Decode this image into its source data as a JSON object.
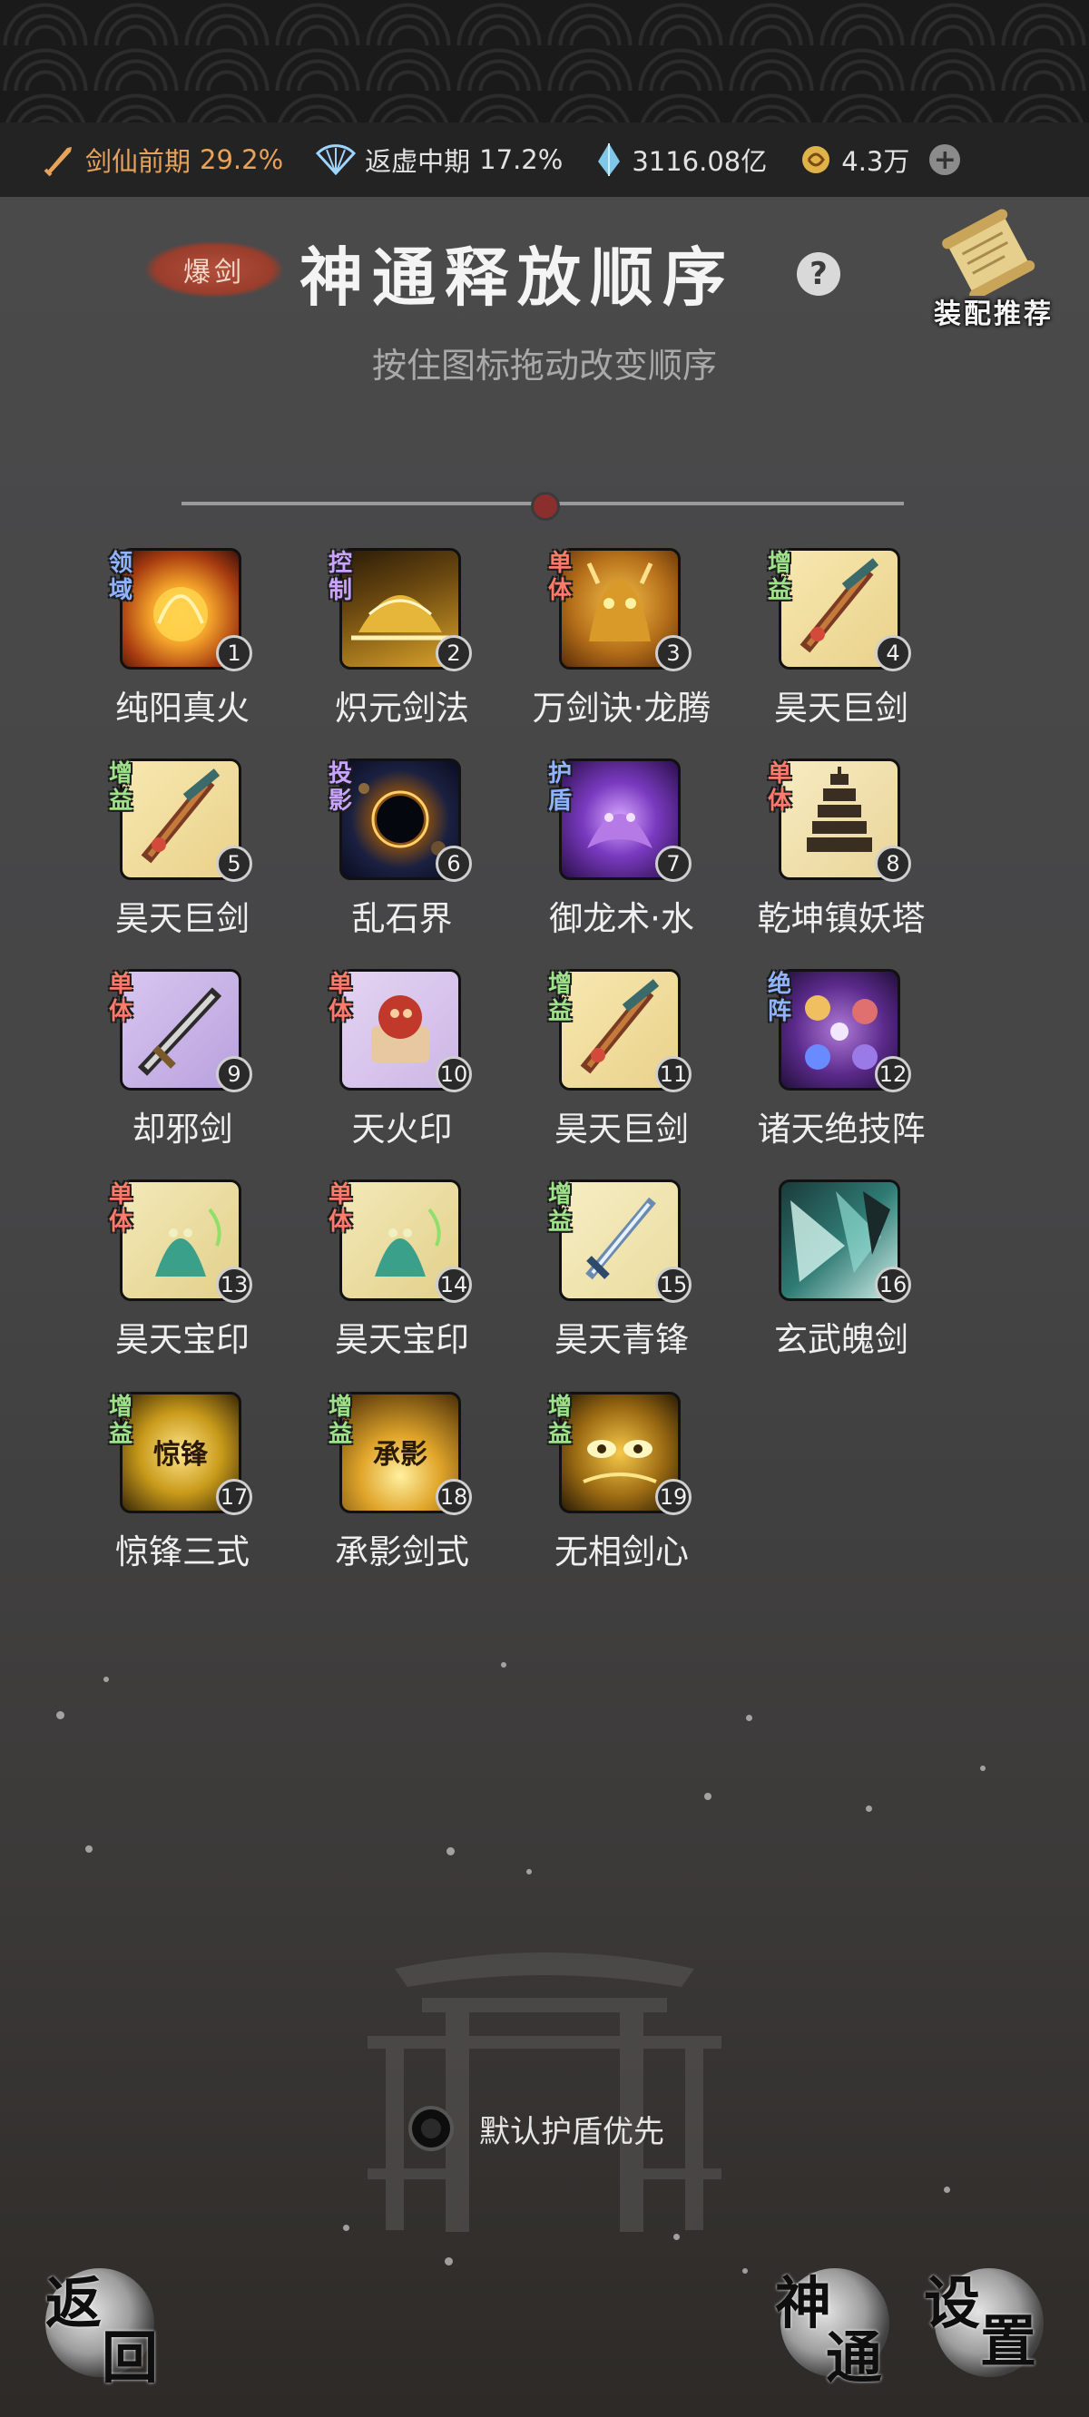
{
  "resources": {
    "sword_realm": {
      "label": "剑仙前期",
      "pct": "29.2%"
    },
    "void_realm": {
      "label": "返虚中期",
      "pct": "17.2%"
    },
    "crystals": "3116.08亿",
    "coins": "4.3万"
  },
  "header": {
    "tag": "爆剑",
    "title": "神通释放顺序",
    "help": "?",
    "recommend_label": "装配推荐",
    "subtitle": "按住图标拖动改变顺序"
  },
  "skills": [
    {
      "tag": "领域",
      "tag_color": "#8fb3ff",
      "num": "1",
      "name": "纯阳真火",
      "theme": "fire-orb"
    },
    {
      "tag": "控制",
      "tag_color": "#c9a3ff",
      "num": "2",
      "name": "炽元剑法",
      "theme": "gold-dome"
    },
    {
      "tag": "单体",
      "tag_color": "#ff7a6a",
      "num": "3",
      "name": "万剑诀·龙腾",
      "theme": "dragon"
    },
    {
      "tag": "增益",
      "tag_color": "#9ee28a",
      "num": "4",
      "name": "昊天巨剑",
      "theme": "great-sword"
    },
    {
      "tag": "增益",
      "tag_color": "#9ee28a",
      "num": "5",
      "name": "昊天巨剑",
      "theme": "great-sword"
    },
    {
      "tag": "投影",
      "tag_color": "#c9a3ff",
      "num": "6",
      "name": "乱石界",
      "theme": "eclipse"
    },
    {
      "tag": "护盾",
      "tag_color": "#8fb3ff",
      "num": "7",
      "name": "御龙术·水",
      "theme": "purple-dragon"
    },
    {
      "tag": "单体",
      "tag_color": "#ff7a6a",
      "num": "8",
      "name": "乾坤镇妖塔",
      "theme": "pagoda"
    },
    {
      "tag": "单体",
      "tag_color": "#ff7a6a",
      "num": "9",
      "name": "却邪剑",
      "theme": "evil-sword"
    },
    {
      "tag": "单体",
      "tag_color": "#ff7a6a",
      "num": "10",
      "name": "天火印",
      "theme": "fire-seal"
    },
    {
      "tag": "增益",
      "tag_color": "#9ee28a",
      "num": "11",
      "name": "昊天巨剑",
      "theme": "great-sword"
    },
    {
      "tag": "绝阵",
      "tag_color": "#8fb3ff",
      "num": "12",
      "name": "诸天绝技阵",
      "theme": "array"
    },
    {
      "tag": "单体",
      "tag_color": "#ff7a6a",
      "num": "13",
      "name": "昊天宝印",
      "theme": "jade-seal"
    },
    {
      "tag": "单体",
      "tag_color": "#ff7a6a",
      "num": "14",
      "name": "昊天宝印",
      "theme": "jade-seal"
    },
    {
      "tag": "增益",
      "tag_color": "#9ee28a",
      "num": "15",
      "name": "昊天青锋",
      "theme": "blue-sword"
    },
    {
      "tag": "",
      "tag_color": "#9ee28a",
      "num": "16",
      "name": "玄武魄剑",
      "theme": "teal-shards"
    },
    {
      "tag": "增益",
      "tag_color": "#9ee28a",
      "num": "17",
      "name": "惊锋三式",
      "theme": "gold-glyph"
    },
    {
      "tag": "增益",
      "tag_color": "#9ee28a",
      "num": "18",
      "name": "承影剑式",
      "theme": "gold-burst"
    },
    {
      "tag": "增益",
      "tag_color": "#9ee28a",
      "num": "19",
      "name": "无相剑心",
      "theme": "gold-eyes"
    }
  ],
  "icon_glyphs": {
    "17": "惊锋",
    "18": "承影"
  },
  "options": {
    "shield_priority": "默认护盾优先"
  },
  "buttons": {
    "back": [
      "返",
      "回"
    ],
    "skills": [
      "神",
      "通"
    ],
    "settings": [
      "设",
      "置"
    ]
  },
  "colors": {
    "accent": "#e8a35a",
    "title": "#f4f4f4",
    "badge_red": "#9a3d2c"
  }
}
